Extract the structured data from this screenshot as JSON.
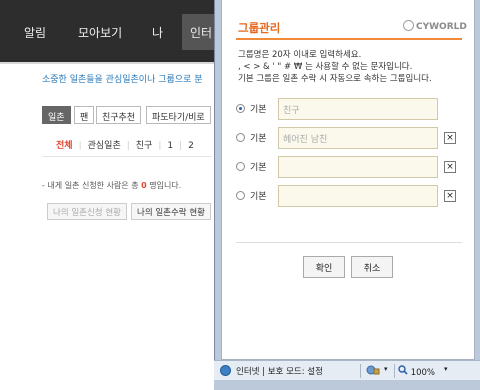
{
  "topnav": {
    "items": [
      "알림",
      "모아보기",
      "나",
      "인터"
    ]
  },
  "intro_text": "소중한 일촌들을 관심일촌이나 그룹으로 분",
  "subtabs": [
    "일촌",
    "팬",
    "친구추천",
    "파도타기/비로"
  ],
  "filters": [
    "전체",
    "관심일촌",
    "친구",
    "1",
    "2"
  ],
  "count_line": {
    "prefix": "- 내게 일촌 신청한 사람은 총 ",
    "count": "0",
    "suffix": " 명입니다."
  },
  "bottom_buttons": [
    "나의 일촌신청 현황",
    "나의 일촌수락 현황"
  ],
  "popup": {
    "title": "그룹관리",
    "logo": "CYWORLD",
    "info_lines": [
      "그룹명은 20자 이내로 입력하세요.",
      ", < > & ' \" # ₩ 는 사용할 수 없는 문자입니다.",
      "기본 그룹은 일촌 수락 시 자동으로 속하는 그룹입니다."
    ],
    "groups": [
      {
        "label": "기본",
        "value": "친구",
        "checked": true,
        "deletable": false
      },
      {
        "label": "기본",
        "value": "헤어진 남친",
        "checked": false,
        "deletable": true
      },
      {
        "label": "기본",
        "value": "",
        "checked": false,
        "deletable": true
      },
      {
        "label": "기본",
        "value": "",
        "checked": false,
        "deletable": true
      }
    ],
    "delete_icon": "×",
    "ok_label": "확인",
    "cancel_label": "취소"
  },
  "statusbar": {
    "zone_text": "인터넷 | 보호 모드: 설정",
    "zoom": "100%",
    "dropdown_glyph": "▾"
  },
  "colors": {
    "accent_orange": "#e56a1e",
    "link_blue": "#2a7ab8",
    "active_red": "#e0462e",
    "nav_bg": "#2d2d2d"
  }
}
